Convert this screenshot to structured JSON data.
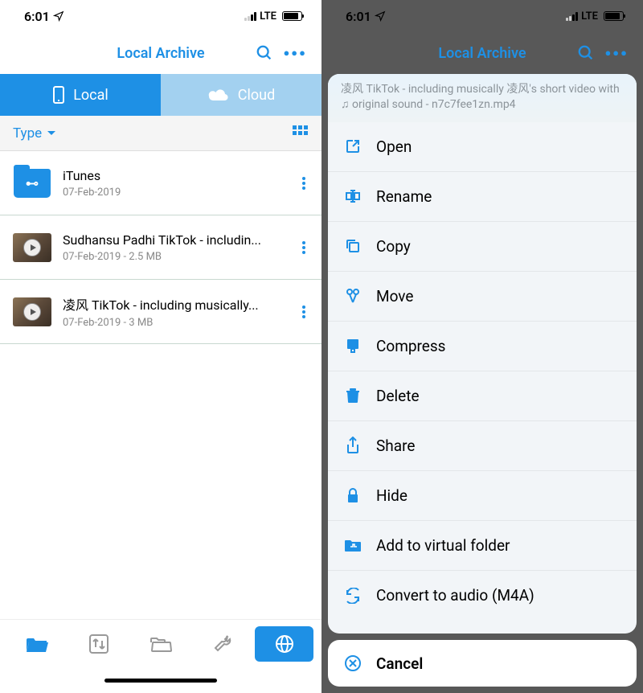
{
  "status": {
    "time": "6:01",
    "network": "LTE"
  },
  "nav": {
    "title": "Local Archive"
  },
  "tabs": {
    "local": "Local",
    "cloud": "Cloud"
  },
  "filter": {
    "label": "Type"
  },
  "items": [
    {
      "title": "iTunes",
      "sub": "07-Feb-2019",
      "type": "folder"
    },
    {
      "title": "Sudhansu Padhi  TikTok - includin...",
      "sub": "07-Feb-2019 - 2.5 MB",
      "type": "video"
    },
    {
      "title": "凌风  TikTok - including musically...",
      "sub": "07-Feb-2019 - 3 MB",
      "type": "video"
    }
  ],
  "sheet": {
    "header": "凌风  TikTok - including musically 凌风's short video with ♫ original sound - n7c7fee1zn.mp4",
    "open": "Open",
    "rename": "Rename",
    "copy": "Copy",
    "move": "Move",
    "compress": "Compress",
    "delete": "Delete",
    "share": "Share",
    "hide": "Hide",
    "virtual": "Add to virtual folder",
    "convert": "Convert to audio (M4A)",
    "cancel": "Cancel"
  }
}
